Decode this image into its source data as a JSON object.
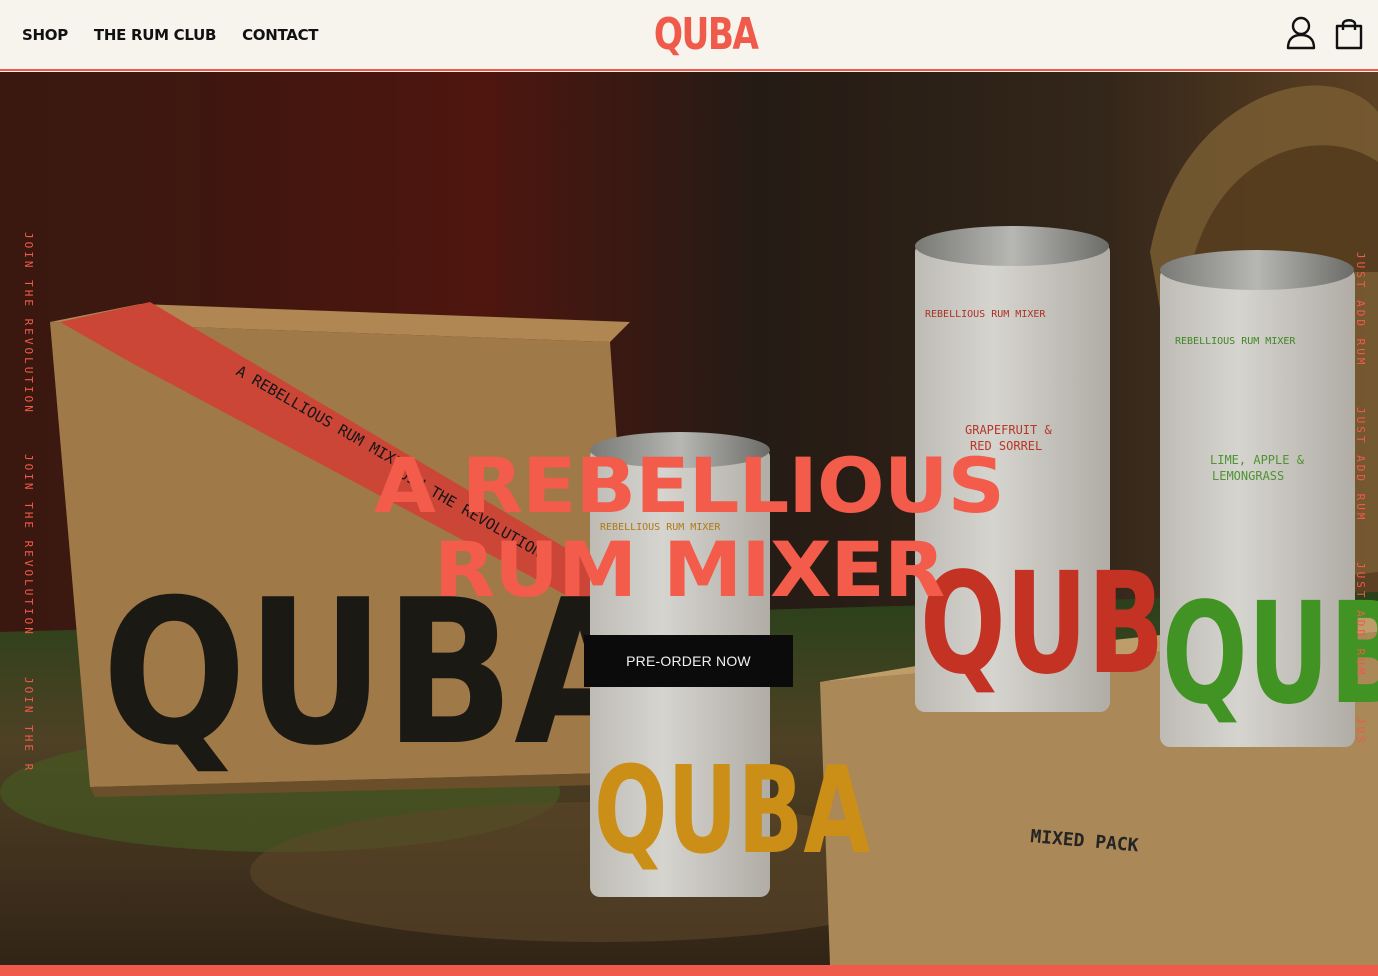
{
  "header": {
    "nav": [
      "SHOP",
      "THE RUM CLUB",
      "CONTACT"
    ],
    "logo": "QUBA",
    "icons": [
      "account-icon",
      "cart-icon"
    ]
  },
  "hero": {
    "image_alt": "Quba rum mixer cans and boxes",
    "headline_line1": "A REBELLIOUS",
    "headline_line2": "RUM MIXER",
    "cta_label": "PRE-ORDER NOW",
    "side_left_text": "JOIN THE REVOLUTION",
    "side_right_text": "JUST ADD RUM",
    "product_texts": {
      "box_tape": "A REBELLIOUS RUM MIXER",
      "box_tape_join": "JOIN THE REVOLUTION",
      "brand": "QUBA",
      "can_band": "REBELLIOUS RUM MIXER",
      "can_red_flavor_1": "GRAPEFRUIT &",
      "can_red_flavor_2": "RED SORREL",
      "can_green_flavor_1": "LIME, APPLE &",
      "can_green_flavor_2": "LEMONGRASS",
      "mixed_pack": "MIXED PACK"
    }
  },
  "colors": {
    "accent": "#f05a4a",
    "headline": "#f35b4b",
    "background": "#f7f4ee",
    "button": "#0b0b0b"
  }
}
